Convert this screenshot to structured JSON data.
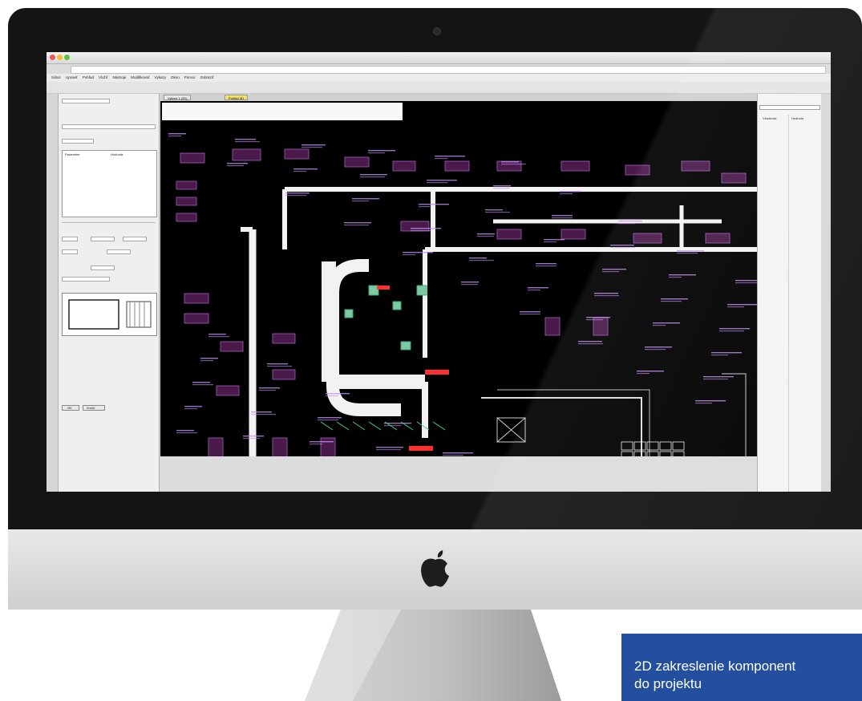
{
  "caption": {
    "line1": "2D zakreslenie komponent",
    "line2": "do projektu"
  },
  "app": {
    "menu": [
      "Súbor",
      "Upraviť",
      "Pohľad",
      "Vložiť",
      "Nástroje",
      "Modifikovať",
      "Výkazy",
      "Okno",
      "Pomoc",
      "Zobraziť"
    ],
    "tabs": [
      "Výkres 1 (2D)",
      "Pohľad 3D"
    ],
    "left_panel": {
      "table_headers": [
        "Parameter",
        "Hodnota"
      ],
      "buttons": [
        "OK",
        "Zrušiť"
      ]
    },
    "right_panel": {
      "headers": [
        "Vlastnosti",
        "Hodnota"
      ]
    }
  },
  "colors": {
    "caption_bg": "#234f9e",
    "cad_bg": "#000000",
    "duct": "#f2f2f2",
    "label_purple": "#c08cf0",
    "equipment_fill": "#4a1a4a",
    "highlight_red": "#ff3030"
  },
  "icons": [
    "apple-logo-icon",
    "camera-icon"
  ]
}
